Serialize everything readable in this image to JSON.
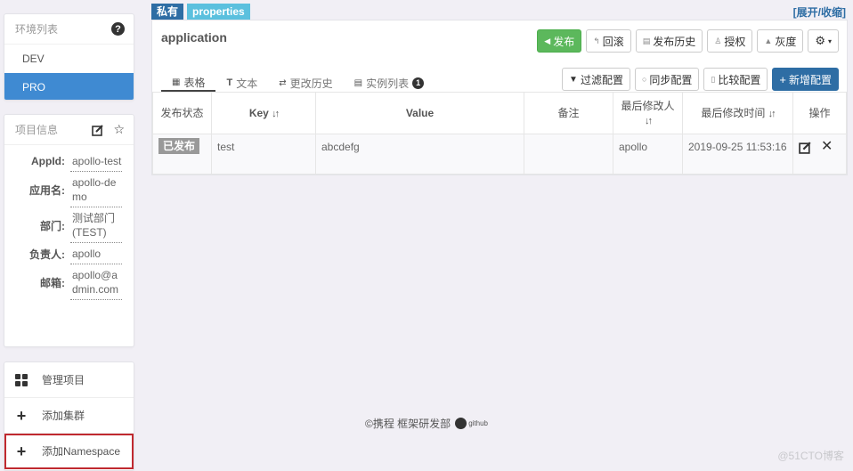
{
  "sidebar": {
    "env_list": {
      "title": "环境列表",
      "help_icon": "question-circle-icon",
      "items": [
        {
          "label": "DEV",
          "active": false
        },
        {
          "label": "PRO",
          "active": true
        }
      ]
    },
    "project_info": {
      "title": "项目信息",
      "edit_icon": "edit-icon",
      "star_icon": "star-icon",
      "rows": [
        {
          "label": "AppId:",
          "value": "apollo-test"
        },
        {
          "label": "应用名:",
          "value": "apollo-demo"
        },
        {
          "label": "部门:",
          "value": "测试部门(TEST)"
        },
        {
          "label": "负责人:",
          "value": "apollo"
        },
        {
          "label": "邮箱:",
          "value": "apollo@admin.com"
        }
      ]
    },
    "actions": [
      {
        "label": "管理项目",
        "icon": "grid-icon"
      },
      {
        "label": "添加集群",
        "icon": "plus-icon"
      },
      {
        "label": "添加Namespace",
        "icon": "plus-icon",
        "highlighted": true
      }
    ]
  },
  "namespace": {
    "badges": {
      "scope": "私有",
      "format": "properties"
    },
    "toggle_link": "[展开/收缩]",
    "title": "application",
    "toolbar": {
      "publish": "发布",
      "rollback": "回滚",
      "publish_history": "发布历史",
      "authorize": "授权",
      "gray": "灰度",
      "settings_icon": "gear-icon"
    },
    "tabs": [
      {
        "label": "表格",
        "icon": "table-icon",
        "active": true
      },
      {
        "label": "文本",
        "icon": "text-icon",
        "active": false
      },
      {
        "label": "更改历史",
        "icon": "history-icon",
        "active": false
      },
      {
        "label": "实例列表",
        "icon": "list-icon",
        "active": false,
        "count": "1"
      }
    ],
    "toolbar2": {
      "filter": "过滤配置",
      "sync": "同步配置",
      "compare": "比较配置",
      "add": "新增配置"
    },
    "table": {
      "headers": [
        "发布状态",
        "Key",
        "Value",
        "备注",
        "最后修改人",
        "最后修改时间",
        "操作"
      ],
      "rows": [
        {
          "status": "已发布",
          "key": "test",
          "value": "abcdefg",
          "comment": "",
          "modifier": "apollo",
          "modified_time": "2019-09-25 11:53:16"
        }
      ]
    }
  },
  "footer": {
    "copyright": "©携程 框架研发部",
    "github": "github"
  },
  "watermark": "@51CTO博客"
}
